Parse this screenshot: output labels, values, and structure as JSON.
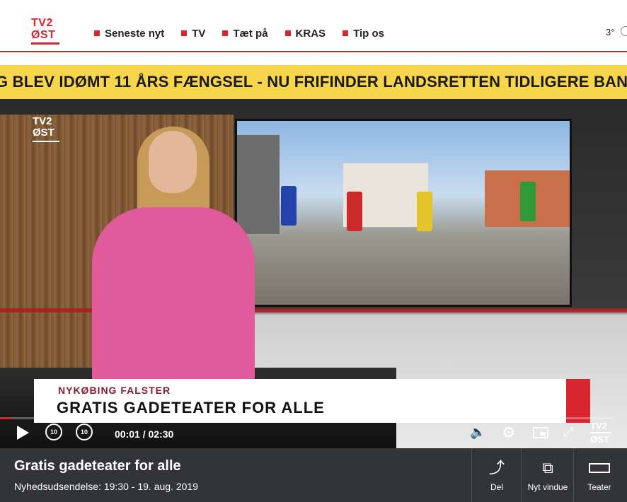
{
  "header": {
    "logo_line1": "TV2",
    "logo_line2": "ØST",
    "nav": [
      {
        "label": "Seneste nyt"
      },
      {
        "label": "TV"
      },
      {
        "label": "Tæt på"
      },
      {
        "label": "KRAS"
      },
      {
        "label": "Tip os"
      }
    ],
    "weather": "3°",
    "accent_color": "#d7262e"
  },
  "ticker": {
    "text": "G   BLEV IDØMT 11 ÅRS FÆNGSEL - NU FRIFINDER LANDSRETTEN TIDLIGERE BAN",
    "background": "#f7d64b"
  },
  "video": {
    "channel_logo_line1": "TV2",
    "channel_logo_line2": "ØST",
    "lower_third": {
      "place": "NYKØBING FALSTER",
      "title": "GRATIS GADETEATER FOR ALLE"
    },
    "progress": 0.007,
    "time": "00:01 / 02:30",
    "skip_back": "10",
    "skip_forward": "10",
    "icons": {
      "play": "play-icon",
      "volume": "volume-icon",
      "settings": "gear-icon",
      "pip": "picture-in-picture-icon",
      "fullscreen": "expand-icon"
    },
    "watermark_line1": "TV2",
    "watermark_line2": "ØST"
  },
  "info": {
    "title": "Gratis gadeteater for alle",
    "subtitle": "Nyhedsudsendelse: 19:30 - 19. aug. 2019",
    "actions": [
      {
        "label": "Del",
        "icon": "share-icon"
      },
      {
        "label": "Nyt vindue",
        "icon": "new-window-icon"
      },
      {
        "label": "Teater",
        "icon": "theater-icon"
      }
    ]
  }
}
